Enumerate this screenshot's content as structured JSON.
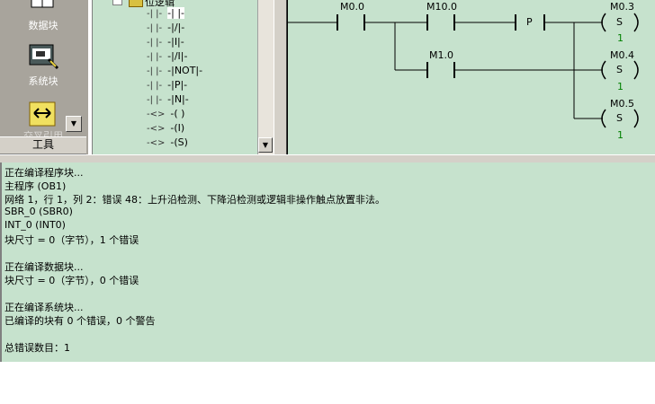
{
  "nav": {
    "items": [
      {
        "label": "数据块",
        "icon": "data-block-icon"
      },
      {
        "label": "系统块",
        "icon": "system-block-icon"
      },
      {
        "label": "交叉引用",
        "icon": "cross-reference-icon"
      }
    ],
    "footer_label": "工具"
  },
  "tree": {
    "folder_label": "位逻辑",
    "items": [
      {
        "glyph": "-| |-",
        "label": "-| |-",
        "icon": "contact-normally-open-icon"
      },
      {
        "glyph": "-| |-",
        "label": "-|/|-",
        "icon": "contact-normally-closed-icon"
      },
      {
        "glyph": "-| |-",
        "label": "-|I|-",
        "icon": "contact-immediate-icon"
      },
      {
        "glyph": "-| |-",
        "label": "-|/I|-",
        "icon": "contact-immediate-closed-icon"
      },
      {
        "glyph": "-| |-",
        "label": "-|NOT|-",
        "icon": "not-contact-icon"
      },
      {
        "glyph": "-| |-",
        "label": "-|P|-",
        "icon": "positive-edge-icon"
      },
      {
        "glyph": "-| |-",
        "label": "-|N|-",
        "icon": "negative-edge-icon"
      },
      {
        "glyph": "-<>",
        "label": "-( )",
        "icon": "coil-icon"
      },
      {
        "glyph": "-<>",
        "label": "-(I)",
        "icon": "coil-immediate-icon"
      },
      {
        "glyph": "-<>",
        "label": "-(S)",
        "icon": "coil-set-icon"
      }
    ]
  },
  "ladder": {
    "contacts": [
      "M0.0",
      "M10.0",
      "M1.0"
    ],
    "edge_label": "P",
    "coils": [
      {
        "address": "M0.3",
        "instr": "S",
        "count": "1"
      },
      {
        "address": "M0.4",
        "instr": "S",
        "count": "1"
      },
      {
        "address": "M0.5",
        "instr": "S",
        "count": "1"
      }
    ]
  },
  "output": {
    "lines": [
      "正在编译程序块...",
      "主程序 (OB1)",
      "网络 1，行 1，列 2：错误 48：上升沿检测、下降沿检测或逻辑非操作触点放置非法。",
      "SBR_0 (SBR0)",
      "INT_0 (INT0)",
      "块尺寸 = 0（字节），1 个错误",
      "",
      "正在编译数据块...",
      "块尺寸 = 0（字节），0 个错误",
      "",
      "正在编译系统块...",
      "已编译的块有 0 个错误，0 个警告",
      "",
      "总错误数目：1"
    ]
  }
}
